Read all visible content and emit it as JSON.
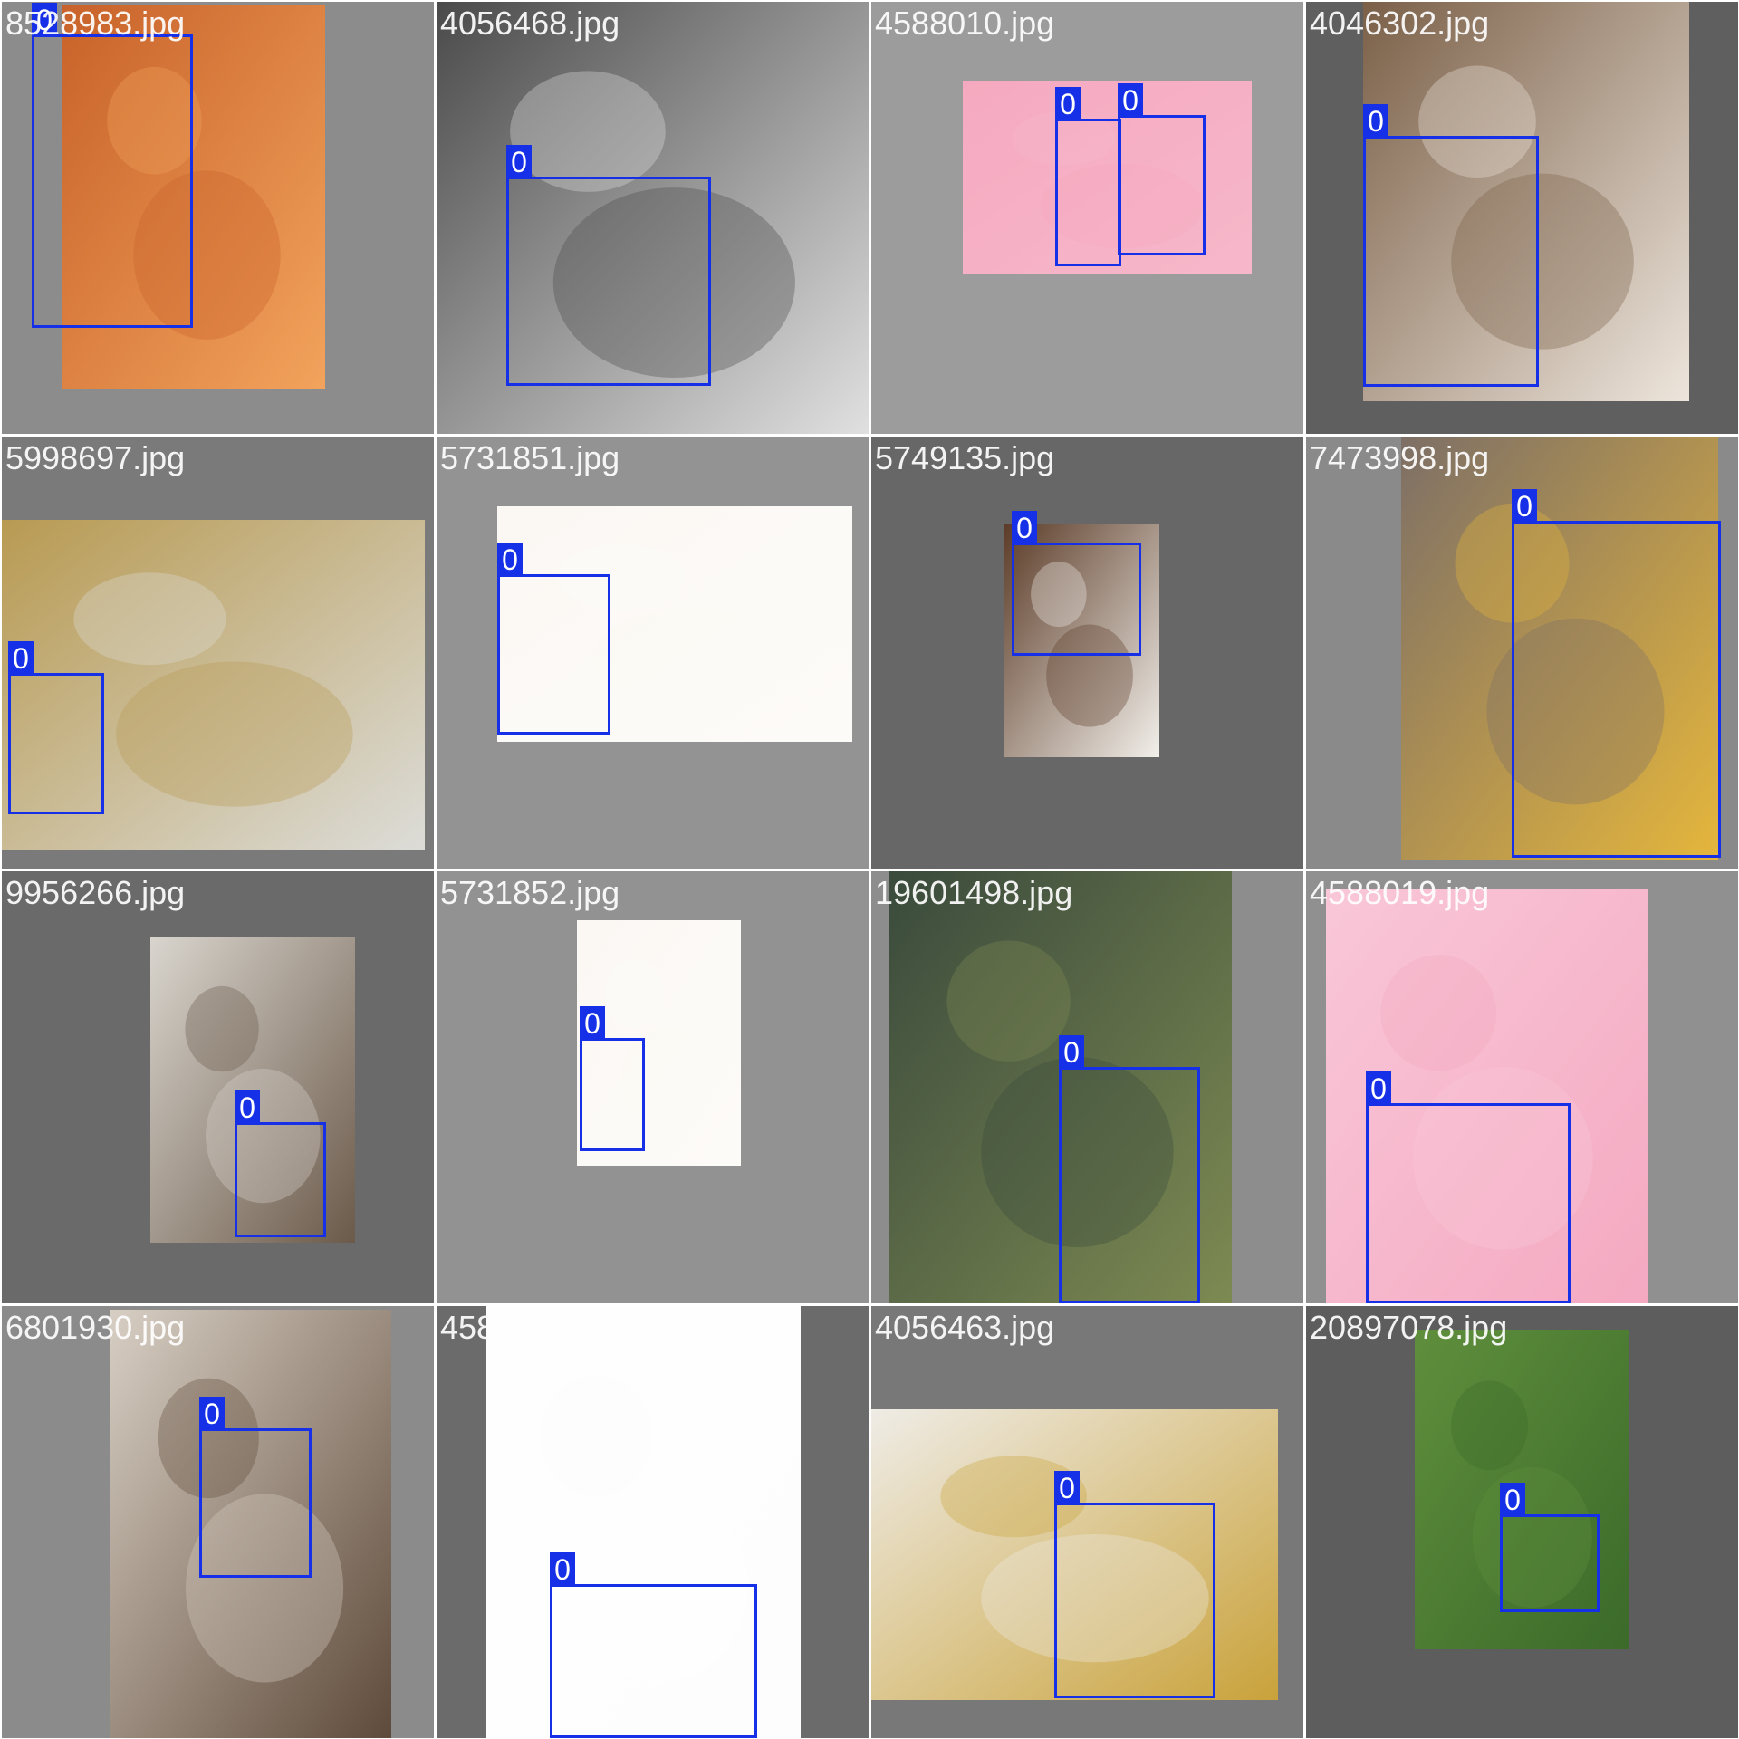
{
  "mosaic": {
    "tiles": [
      {
        "filename": "8528983.jpg",
        "background": "#8c8c8c",
        "photo_colors": [
          "#c8622a",
          "#f2a35c"
        ],
        "detections": [
          {
            "label": "0"
          }
        ]
      },
      {
        "filename": "4056468.jpg",
        "background": "#a3a3a3",
        "photo_colors": [
          "#4a4a4a",
          "#e0e0e0"
        ],
        "detections": [
          {
            "label": "0"
          }
        ]
      },
      {
        "filename": "4588010.jpg",
        "background": "#9c9c9c",
        "photo_colors": [
          "#f5a9c0",
          "#f7b7ca"
        ],
        "detections": [
          {
            "label": "0"
          },
          {
            "label": "0"
          }
        ]
      },
      {
        "filename": "4046302.jpg",
        "background": "#5f5f5f",
        "photo_colors": [
          "#7b6048",
          "#ede5dc"
        ],
        "detections": [
          {
            "label": "0"
          }
        ]
      },
      {
        "filename": "5998697.jpg",
        "background": "#7a7a7a",
        "photo_colors": [
          "#b89a52",
          "#dcdcd8"
        ],
        "detections": [
          {
            "label": "0"
          }
        ]
      },
      {
        "filename": "5731851.jpg",
        "background": "#939393",
        "photo_colors": [
          "#fbf8f4",
          "#fdfbf8"
        ],
        "detections": [
          {
            "label": "0"
          }
        ]
      },
      {
        "filename": "5749135.jpg",
        "background": "#676767",
        "photo_colors": [
          "#5c3c28",
          "#f2efea"
        ],
        "detections": [
          {
            "label": "0"
          }
        ]
      },
      {
        "filename": "7473998.jpg",
        "background": "#8a8a8a",
        "photo_colors": [
          "#7d6f66",
          "#e5b63c"
        ],
        "detections": [
          {
            "label": "0"
          }
        ]
      },
      {
        "filename": "9956266.jpg",
        "background": "#6a6a6a",
        "photo_colors": [
          "#d9d5ce",
          "#6b5a4a"
        ],
        "detections": [
          {
            "label": "0"
          }
        ]
      },
      {
        "filename": "5731852.jpg",
        "background": "#929292",
        "photo_colors": [
          "#fbf8f4",
          "#fdfbf8"
        ],
        "detections": [
          {
            "label": "0"
          }
        ]
      },
      {
        "filename": "19601498.jpg",
        "background": "#8d8d8d",
        "photo_colors": [
          "#3a4a3c",
          "#7d8a52"
        ],
        "detections": [
          {
            "label": "0"
          }
        ]
      },
      {
        "filename": "4588019.jpg",
        "background": "#909090",
        "photo_colors": [
          "#f9c7d8",
          "#f4a9c1"
        ],
        "detections": [
          {
            "label": "0"
          }
        ]
      },
      {
        "filename": "6801930.jpg",
        "background": "#8b8b8b",
        "photo_colors": [
          "#d8cfc4",
          "#5e4a3a"
        ],
        "detections": [
          {
            "label": "0"
          }
        ]
      },
      {
        "filename": "4588052.jpg",
        "background": "#6b6b6b",
        "photo_colors": [
          "#fefefe",
          "#fdfdfd"
        ],
        "detections": [
          {
            "label": "0"
          }
        ]
      },
      {
        "filename": "4056463.jpg",
        "background": "#787878",
        "photo_colors": [
          "#efece6",
          "#c9a23a"
        ],
        "detections": [
          {
            "label": "0"
          }
        ]
      },
      {
        "filename": "20897078.jpg",
        "background": "#5d5d5d",
        "photo_colors": [
          "#5f8f3c",
          "#3b6a2a"
        ],
        "detections": [
          {
            "label": "0"
          }
        ]
      }
    ]
  }
}
